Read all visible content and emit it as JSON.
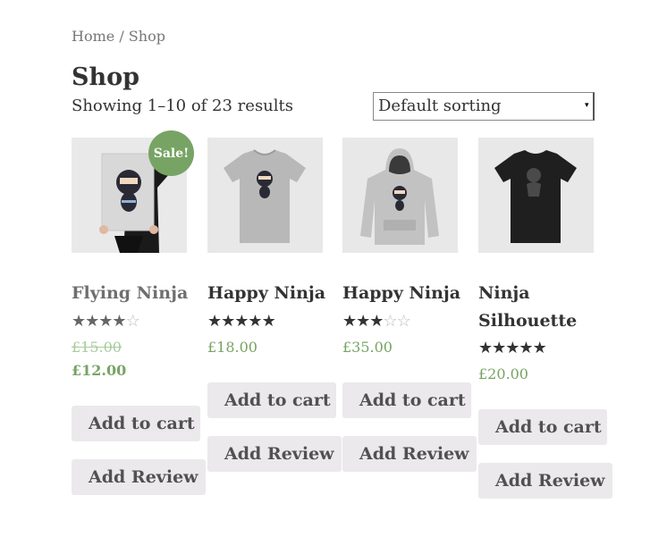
{
  "breadcrumb": {
    "home": "Home",
    "separator": " / ",
    "current": "Shop"
  },
  "page_title": "Shop",
  "result_count": "Showing 1–10 of 23 results",
  "sorting": {
    "selected": "Default sorting",
    "arrow_icon": "chevron-down-icon"
  },
  "colors": {
    "accent_green": "#77a464",
    "button_bg": "#ebe9eb",
    "text": "#333333"
  },
  "products": [
    {
      "name": "Flying Ninja",
      "rating": 4,
      "rating_max": 5,
      "regular_price": "£15.00",
      "sale_price": "£12.00",
      "sale_badge": "Sale!",
      "add_to_cart": "Add to cart",
      "add_review": "Add Review",
      "image_icon": "poster-ninja-image"
    },
    {
      "name": "Happy Ninja",
      "rating": 5,
      "rating_max": 5,
      "price": "£18.00",
      "add_to_cart": "Add to cart",
      "add_review": "Add Review",
      "image_icon": "tshirt-image"
    },
    {
      "name": "Happy Ninja",
      "rating": 3,
      "rating_max": 5,
      "price": "£35.00",
      "add_to_cart": "Add to cart",
      "add_review": "Add Review",
      "image_icon": "hoodie-image"
    },
    {
      "name": "Ninja Silhouette",
      "rating": 5,
      "rating_max": 5,
      "price": "£20.00",
      "add_to_cart": "Add to cart",
      "add_review": "Add Review",
      "image_icon": "black-tshirt-image"
    }
  ]
}
